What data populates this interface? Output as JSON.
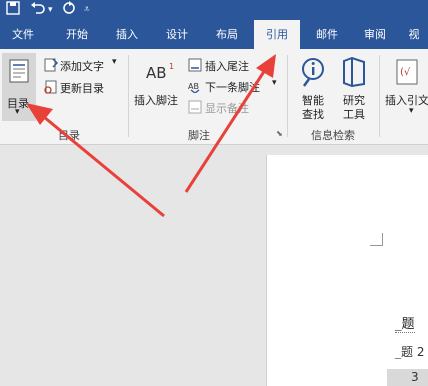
{
  "quick_access": {
    "save": "save-icon",
    "undo": "undo-icon",
    "redo": "redo-icon"
  },
  "tabs": [
    "文件",
    "开始",
    "插入",
    "设计",
    "布局",
    "引用",
    "邮件",
    "审阅",
    "视"
  ],
  "active_tab": "引用",
  "ribbon": {
    "toc": {
      "label": "目录",
      "add_text": "添加文字",
      "update": "更新目录",
      "group": "目录"
    },
    "footnotes": {
      "insert_footnote": "插入脚注",
      "insert_endnote": "插入尾注",
      "next_footnote": "下一条脚注",
      "show_notes": "显示备注",
      "group": "脚注"
    },
    "research": {
      "smart_lookup_1": "智能",
      "smart_lookup_2": "查找",
      "researcher_1": "研究",
      "researcher_2": "工具",
      "group": "信息检索"
    },
    "citations": {
      "insert_citation": "插入引文"
    }
  },
  "document": {
    "line1": "题",
    "line2": "题 2",
    "line3": "3"
  },
  "colors": {
    "brand": "#2b579a",
    "arrow": "#e8413a"
  }
}
